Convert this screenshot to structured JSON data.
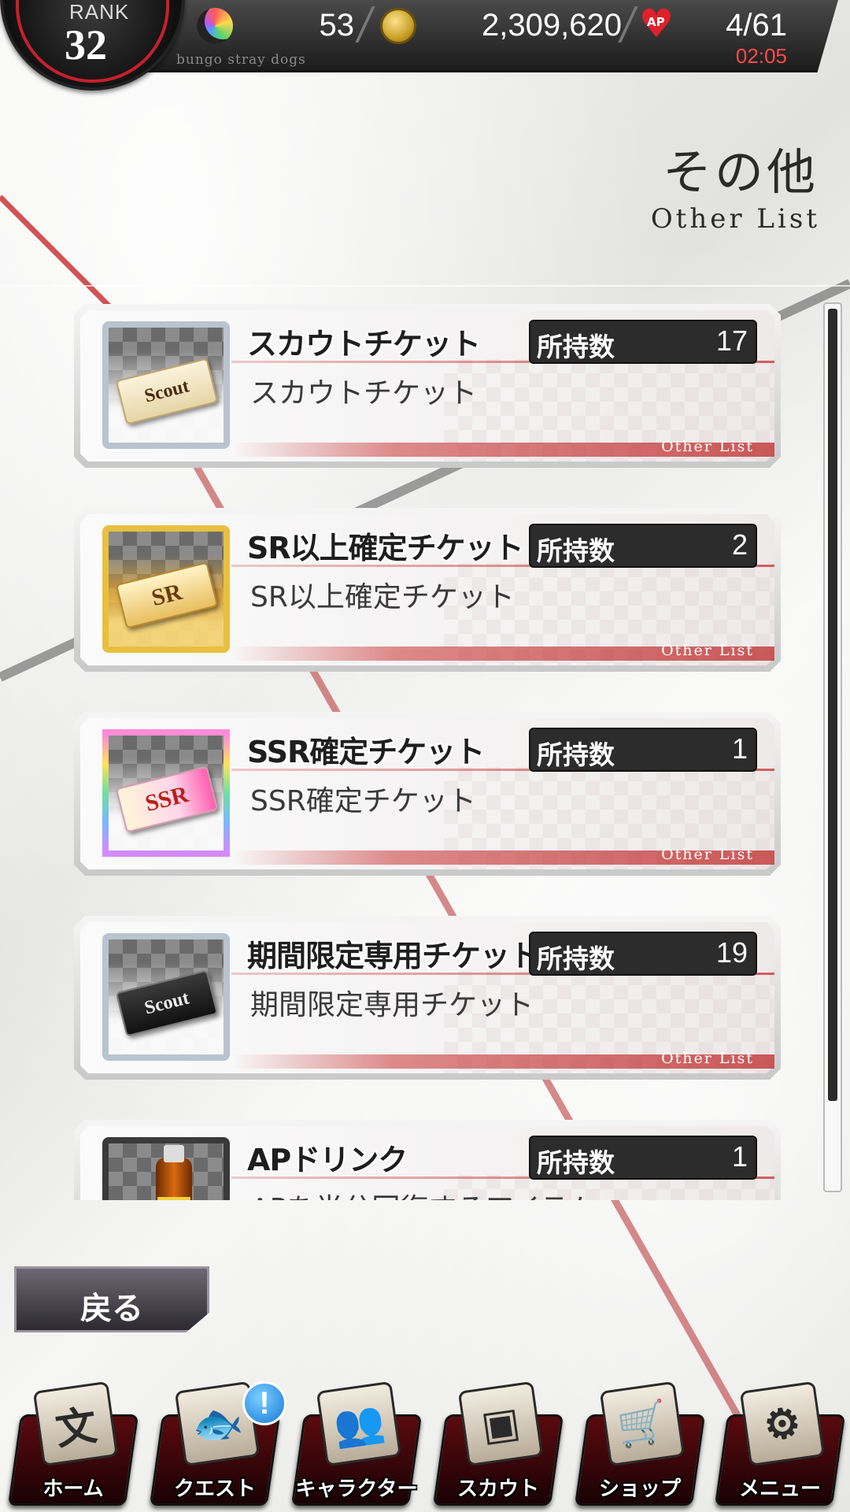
{
  "header": {
    "rank_label": "RANK",
    "rank_value": "32",
    "moon_count": "53",
    "coins": "2,309,620",
    "ap_label": "AP",
    "ap": "4/61",
    "ap_timer": "02:05",
    "game_subtitle": "bungo stray dogs"
  },
  "page": {
    "title": "その他",
    "subtitle": "Other List"
  },
  "list": {
    "owned_label": "所持数",
    "tag": "Other List",
    "items": [
      {
        "name": "スカウトチケット",
        "desc": "スカウトチケット",
        "count": "17",
        "ticket_text": "Scout",
        "icon": "scout-ticket-icon"
      },
      {
        "name": "SR以上確定チケット",
        "desc": "SR以上確定チケット",
        "count": "2",
        "ticket_text": "SR",
        "icon": "sr-ticket-icon"
      },
      {
        "name": "SSR確定チケット",
        "desc": "SSR確定チケット",
        "count": "1",
        "ticket_text": "SSR",
        "icon": "ssr-ticket-icon"
      },
      {
        "name": "期間限定専用チケット",
        "desc": "期間限定専用チケット",
        "count": "19",
        "ticket_text": "Scout",
        "icon": "limited-scout-ticket-icon"
      },
      {
        "name": "APドリンク",
        "desc": "APを半分回復するアイテム",
        "count": "1",
        "ticket_text": "",
        "icon": "ap-drink-icon"
      }
    ]
  },
  "back_button": "戻る",
  "nav": {
    "home": "ホーム",
    "home_glyph": "文",
    "quest": "クエスト",
    "quest_glyph": "🐟",
    "quest_badge": "!",
    "character": "キャラクター",
    "character_glyph": "👥",
    "scout": "スカウト",
    "scout_glyph": "▣",
    "shop": "ショップ",
    "shop_glyph": "🛒",
    "menu": "メニュー",
    "menu_glyph": "⚙"
  },
  "colors": {
    "accent_red": "#c8202a",
    "header_dark": "#1c1c1c"
  }
}
